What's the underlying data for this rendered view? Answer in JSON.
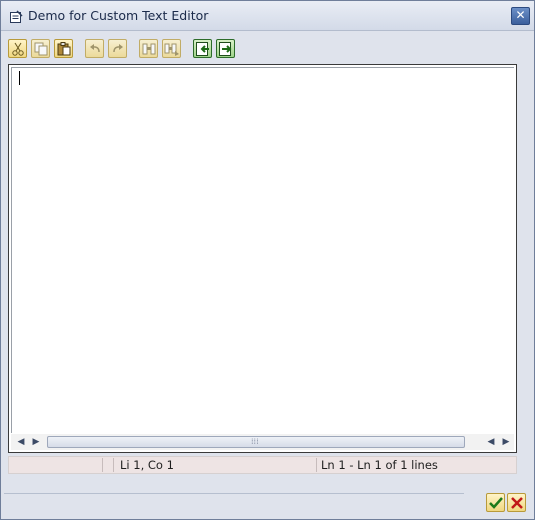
{
  "window": {
    "title": "Demo for Custom Text Editor",
    "close_symbol": "✕"
  },
  "toolbar": {
    "buttons": [
      {
        "name": "cut-button",
        "icon": "scissors-icon"
      },
      {
        "name": "copy-button",
        "icon": "copy-icon"
      },
      {
        "name": "paste-button",
        "icon": "paste-icon"
      },
      {
        "name": "undo-button",
        "icon": "undo-icon"
      },
      {
        "name": "redo-button",
        "icon": "redo-icon"
      },
      {
        "name": "find-button",
        "icon": "binoculars-icon"
      },
      {
        "name": "find-next-button",
        "icon": "find-next-icon"
      },
      {
        "name": "load-local-file-button",
        "icon": "import-icon"
      },
      {
        "name": "save-local-file-button",
        "icon": "export-icon"
      }
    ]
  },
  "editor": {
    "content": ""
  },
  "scrollbar": {
    "left_arrow": "◀",
    "right_arrow": "▶",
    "grip": "⁞⁞⁞"
  },
  "status": {
    "cell1": "",
    "cell2": "Li 1, Co 1",
    "cell3": "Ln 1 - Ln 1 of 1 lines"
  },
  "colors": {
    "accent": "#3b5f9d",
    "button_face": "#f0d780",
    "status_bg": "#eee4e4"
  }
}
